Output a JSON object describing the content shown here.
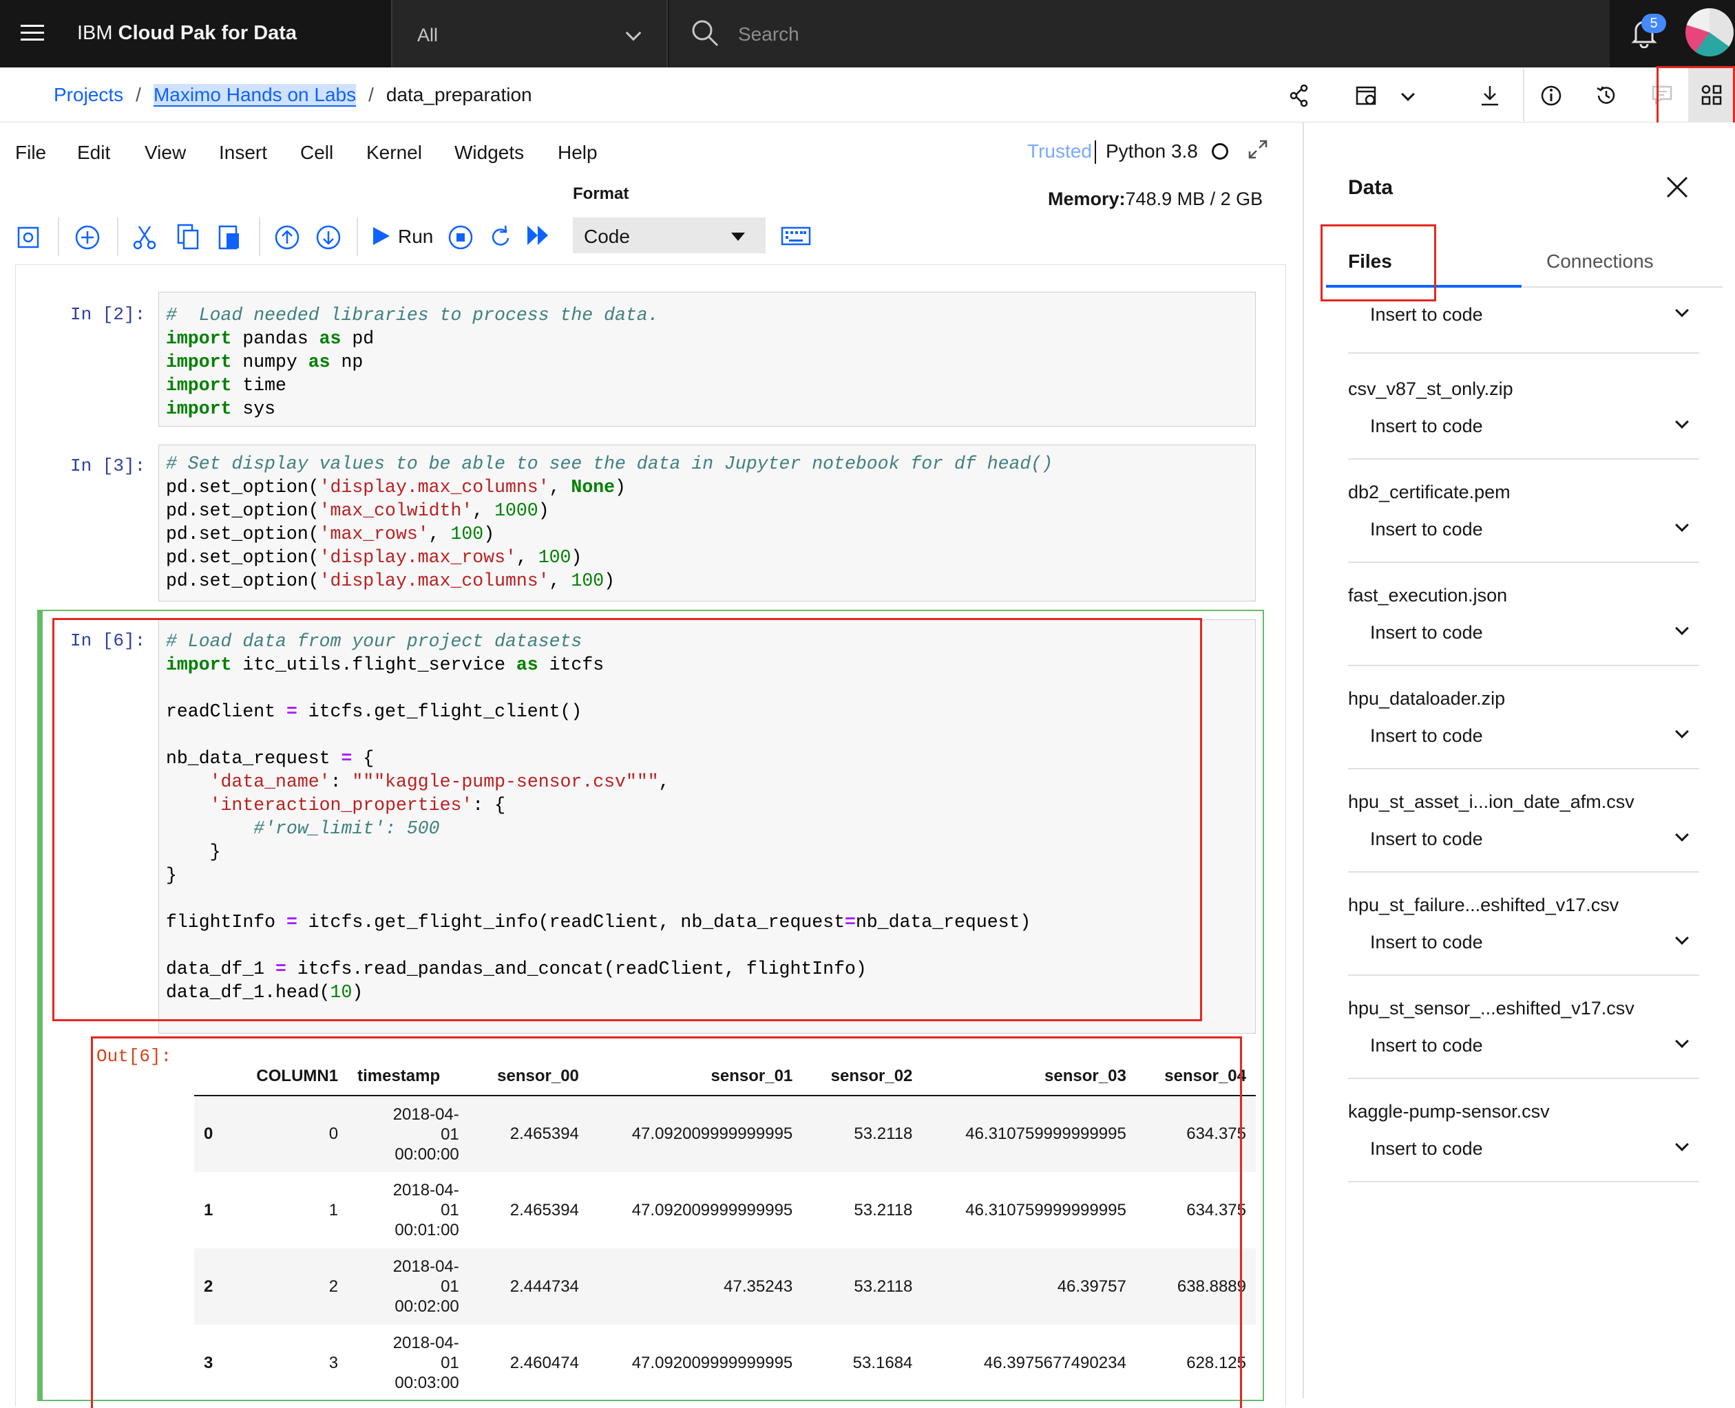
{
  "topbar": {
    "brand_prefix": "IBM ",
    "brand_name": "Cloud Pak for Data",
    "scope": "All",
    "search_placeholder": "Search",
    "notifications_count": "5"
  },
  "breadcrumb": {
    "projects": "Projects",
    "project": "Maximo Hands on Labs",
    "notebook": "data_preparation",
    "separator": "/"
  },
  "menu": {
    "items": [
      "File",
      "Edit",
      "View",
      "Insert",
      "Cell",
      "Kernel",
      "Widgets",
      "Help"
    ],
    "trusted": "Trusted",
    "kernel": "Python 3.8"
  },
  "toolbar": {
    "format_label": "Format",
    "memory_label": "Memory:",
    "memory_value": "748.9 MB / 2 GB",
    "run_label": "Run",
    "cell_type": "Code"
  },
  "cells": [
    {
      "prompt": "In [2]:",
      "lines": [
        [
          [
            "cm",
            "#  Load needed libraries to process the data."
          ]
        ],
        [
          [
            "kw",
            "import"
          ],
          [
            "",
            " pandas "
          ],
          [
            "kw",
            "as"
          ],
          [
            "",
            " pd"
          ]
        ],
        [
          [
            "kw",
            "import"
          ],
          [
            "",
            " numpy "
          ],
          [
            "kw",
            "as"
          ],
          [
            "",
            " np"
          ]
        ],
        [
          [
            "kw",
            "import"
          ],
          [
            "",
            " time"
          ]
        ],
        [
          [
            "kw",
            "import"
          ],
          [
            "",
            " sys"
          ]
        ]
      ]
    },
    {
      "prompt": "In [3]:",
      "lines": [
        [
          [
            "cm",
            "# Set display values to be able to see the data in Jupyter notebook for df head()"
          ]
        ],
        [
          [
            "",
            "pd.set_option("
          ],
          [
            "st",
            "'display.max_columns'"
          ],
          [
            "",
            ", "
          ],
          [
            "kw",
            "None"
          ],
          [
            "",
            ")"
          ]
        ],
        [
          [
            "",
            "pd.set_option("
          ],
          [
            "st",
            "'max_colwidth'"
          ],
          [
            "",
            ", "
          ],
          [
            "nu",
            "1000"
          ],
          [
            "",
            ")"
          ]
        ],
        [
          [
            "",
            "pd.set_option("
          ],
          [
            "st",
            "'max_rows'"
          ],
          [
            "",
            ", "
          ],
          [
            "nu",
            "100"
          ],
          [
            "",
            ")"
          ]
        ],
        [
          [
            "",
            "pd.set_option("
          ],
          [
            "st",
            "'display.max_rows'"
          ],
          [
            "",
            ", "
          ],
          [
            "nu",
            "100"
          ],
          [
            "",
            ")"
          ]
        ],
        [
          [
            "",
            "pd.set_option("
          ],
          [
            "st",
            "'display.max_columns'"
          ],
          [
            "",
            ", "
          ],
          [
            "nu",
            "100"
          ],
          [
            "",
            ")"
          ]
        ]
      ]
    },
    {
      "prompt": "In [6]:",
      "lines": [
        [
          [
            "cm",
            "# Load data from your project datasets"
          ]
        ],
        [
          [
            "kw",
            "import"
          ],
          [
            "",
            " itc_utils.flight_service "
          ],
          [
            "kw",
            "as"
          ],
          [
            "",
            " itcfs"
          ]
        ],
        [
          [
            "",
            ""
          ]
        ],
        [
          [
            "",
            "readClient "
          ],
          [
            "op",
            "="
          ],
          [
            "",
            " itcfs.get_flight_client()"
          ]
        ],
        [
          [
            "",
            ""
          ]
        ],
        [
          [
            "",
            "nb_data_request "
          ],
          [
            "op",
            "="
          ],
          [
            "",
            " {"
          ]
        ],
        [
          [
            "",
            "    "
          ],
          [
            "st",
            "'data_name'"
          ],
          [
            "",
            ": "
          ],
          [
            "st",
            "\"\"\"kaggle-pump-sensor.csv\"\"\""
          ],
          [
            "",
            ","
          ]
        ],
        [
          [
            "",
            "    "
          ],
          [
            "st",
            "'interaction_properties'"
          ],
          [
            "",
            ": {"
          ]
        ],
        [
          [
            "",
            "        "
          ],
          [
            "cm",
            "#'row_limit': 500"
          ]
        ],
        [
          [
            "",
            "    }"
          ]
        ],
        [
          [
            "",
            "}"
          ]
        ],
        [
          [
            "",
            ""
          ]
        ],
        [
          [
            "",
            "flightInfo "
          ],
          [
            "op",
            "="
          ],
          [
            "",
            " itcfs.get_flight_info(readClient, nb_data_request"
          ],
          [
            "op",
            "="
          ],
          [
            "",
            "nb_data_request)"
          ]
        ],
        [
          [
            "",
            ""
          ]
        ],
        [
          [
            "",
            "data_df_1 "
          ],
          [
            "op",
            "="
          ],
          [
            "",
            " itcfs.read_pandas_and_concat(readClient, flightInfo)"
          ]
        ],
        [
          [
            "",
            "data_df_1.head("
          ],
          [
            "nu",
            "10"
          ],
          [
            "",
            ")"
          ]
        ]
      ]
    }
  ],
  "output": {
    "prompt": "Out[6]:",
    "columns": [
      "",
      "COLUMN1",
      "timestamp",
      "sensor_00",
      "sensor_01",
      "sensor_02",
      "sensor_03",
      "sensor_04"
    ],
    "rows": [
      {
        "idx": "0",
        "c1": "0",
        "ts": [
          "2018-04-",
          "01",
          "00:00:00"
        ],
        "s00": "2.465394",
        "s01": "47.092009999999995",
        "s02": "53.2118",
        "s03": "46.310759999999995",
        "s04": "634.375"
      },
      {
        "idx": "1",
        "c1": "1",
        "ts": [
          "2018-04-",
          "01",
          "00:01:00"
        ],
        "s00": "2.465394",
        "s01": "47.092009999999995",
        "s02": "53.2118",
        "s03": "46.310759999999995",
        "s04": "634.375"
      },
      {
        "idx": "2",
        "c1": "2",
        "ts": [
          "2018-04-",
          "01",
          "00:02:00"
        ],
        "s00": "2.444734",
        "s01": "47.35243",
        "s02": "53.2118",
        "s03": "46.39757",
        "s04": "638.8889"
      },
      {
        "idx": "3",
        "c1": "3",
        "ts": [
          "2018-04-",
          "01",
          "00:03:00"
        ],
        "s00": "2.460474",
        "s01": "47.092009999999995",
        "s02": "53.1684",
        "s03": "46.3975677490234",
        "s04": "628.125"
      }
    ]
  },
  "panel": {
    "title": "Data",
    "tab_files": "Files",
    "tab_connections": "Connections",
    "insert_label": "Insert to code",
    "files": [
      "",
      "csv_v87_st_only.zip",
      "db2_certificate.pem",
      "fast_execution.json",
      "hpu_dataloader.zip",
      "hpu_st_asset_i...ion_date_afm.csv",
      "hpu_st_failure...eshifted_v17.csv",
      "hpu_st_sensor_...eshifted_v17.csv",
      "kaggle-pump-sensor.csv"
    ]
  }
}
